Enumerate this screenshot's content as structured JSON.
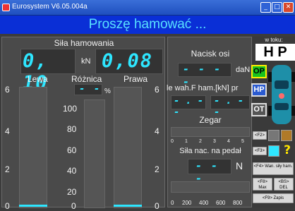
{
  "window": {
    "title": "Eurosystem V6.05.004a",
    "minimize": "_",
    "maximize": "□",
    "close": "✕"
  },
  "banner": "Proszę hamować ...",
  "left_panel": {
    "title": "Siła hamowania",
    "left_value": "0, 10",
    "unit": "kN",
    "right_value": "0,08",
    "left_label": "Lewa",
    "diff_label": "Różnica",
    "right_label": "Prawa",
    "diff_value": "- -",
    "diff_unit": "%",
    "left_scale": [
      "6",
      "4",
      "2",
      "0"
    ],
    "diff_scale": [
      "100",
      "80",
      "60",
      "40",
      "20",
      "0"
    ],
    "right_scale": [
      "6",
      "4",
      "2",
      "0"
    ]
  },
  "middle_panel": {
    "axle_label": "Nacisk osi",
    "axle_value": "- - - -",
    "axle_unit": "daN",
    "wah_label": "le wah.F ham.[kN] pr",
    "wah_left": "- . - -",
    "wah_right": "- . - -",
    "clock_label": "Zegar",
    "clock_scale": [
      "0",
      "1",
      "2",
      "3",
      "4",
      "5"
    ],
    "pedal_label": "Siła nac. na pedał",
    "pedal_value": "- - -",
    "pedal_unit": "N",
    "pedal_scale": [
      "0",
      "200",
      "400",
      "600",
      "800"
    ]
  },
  "right_panel": {
    "w_toku": "w toku:",
    "mode_big": "H P",
    "op": "OP",
    "hp": "HP",
    "ot": "OT",
    "f2": "<F2>",
    "f3": "<F3>",
    "f4": "<F4> Wan. siły ham.",
    "f8": "<F8> Max",
    "bs": "<BS> DEL",
    "f9": "<F9> Zapis",
    "help": "?",
    "colors": {
      "op": "#19c21e",
      "accent": "#2ee6ff"
    }
  }
}
